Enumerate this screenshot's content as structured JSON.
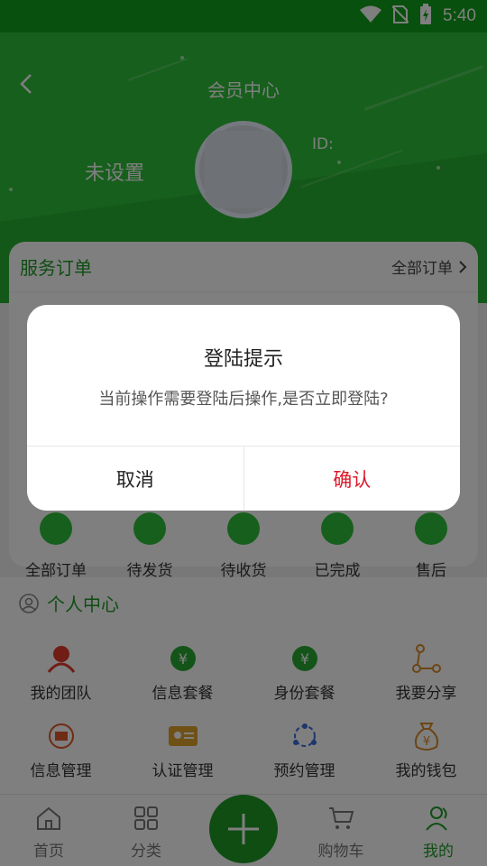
{
  "status_bar": {
    "time": "5:40",
    "icons": [
      "wifi-icon",
      "no-sim-icon",
      "battery-charging-icon"
    ]
  },
  "header": {
    "title": "会员中心",
    "nickname": "未设置",
    "id_label": "ID:"
  },
  "service_orders": {
    "title": "服务订单",
    "all_orders": "全部订单",
    "statuses": [
      "全部订单",
      "待发货",
      "待收货",
      "已完成",
      "售后"
    ]
  },
  "personal_center": {
    "title": "个人中心",
    "items": [
      {
        "label": "我的团队",
        "icon": "team-icon"
      },
      {
        "label": "信息套餐",
        "icon": "yen-coin-icon"
      },
      {
        "label": "身份套餐",
        "icon": "yen-coin-icon"
      },
      {
        "label": "我要分享",
        "icon": "share-icon"
      },
      {
        "label": "信息管理",
        "icon": "info-manage-icon"
      },
      {
        "label": "认证管理",
        "icon": "id-card-icon"
      },
      {
        "label": "预约管理",
        "icon": "appointment-icon"
      },
      {
        "label": "我的钱包",
        "icon": "money-bag-icon"
      }
    ]
  },
  "bottom_nav": {
    "home": "首页",
    "category": "分类",
    "cart": "购物车",
    "mine": "我的"
  },
  "dialog": {
    "title": "登陆提示",
    "message": "当前操作需要登陆后操作,是否立即登陆?",
    "cancel": "取消",
    "confirm": "确认"
  },
  "colors": {
    "primary": "#2fbf3b",
    "status_bar": "#11a11b",
    "confirm": "#e0182a"
  }
}
